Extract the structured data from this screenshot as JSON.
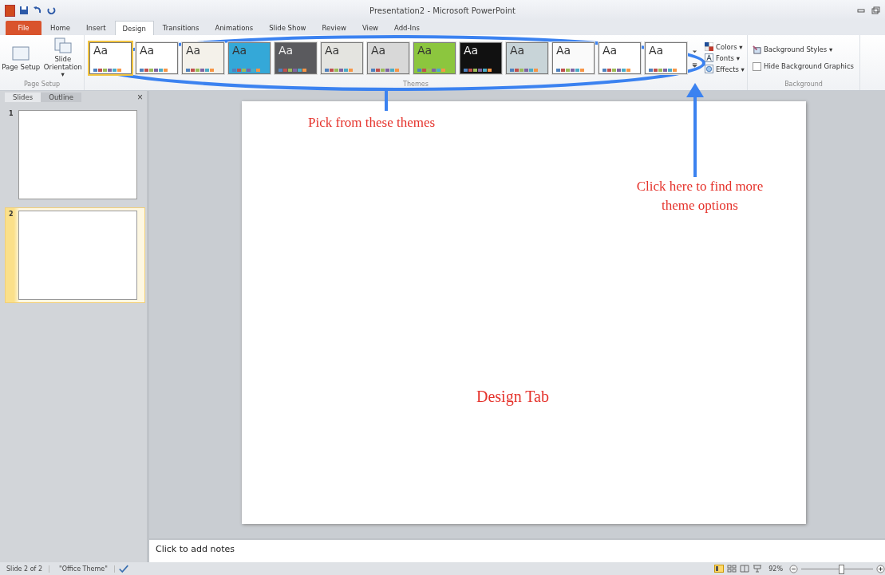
{
  "window": {
    "title": "Presentation2  -  Microsoft PowerPoint"
  },
  "tabs": [
    {
      "label": "File",
      "kind": "file",
      "selected": false
    },
    {
      "label": "Home",
      "kind": "tab",
      "selected": false
    },
    {
      "label": "Insert",
      "kind": "tab",
      "selected": false
    },
    {
      "label": "Design",
      "kind": "tab",
      "selected": true
    },
    {
      "label": "Transitions",
      "kind": "tab",
      "selected": false
    },
    {
      "label": "Animations",
      "kind": "tab",
      "selected": false
    },
    {
      "label": "Slide Show",
      "kind": "tab",
      "selected": false
    },
    {
      "label": "Review",
      "kind": "tab",
      "selected": false
    },
    {
      "label": "View",
      "kind": "tab",
      "selected": false
    },
    {
      "label": "Add-Ins",
      "kind": "tab",
      "selected": false
    }
  ],
  "page_setup": {
    "buttons": [
      {
        "label": "Page Setup",
        "kind": "page"
      },
      {
        "label": "Slide Orientation ▾",
        "kind": "orient"
      }
    ],
    "group_label": "Page Setup"
  },
  "themes": {
    "items": [
      {
        "label": "Aa",
        "color": "#ffffff",
        "selected": true
      },
      {
        "label": "Aa",
        "color": "#ffffff",
        "selected": false
      },
      {
        "label": "Aa",
        "color": "#f4f1ea",
        "selected": false
      },
      {
        "label": "Aa",
        "color": "#34a8d8",
        "selected": false
      },
      {
        "label": "Aa",
        "color": "#5a5a5e",
        "selected": false
      },
      {
        "label": "Aa",
        "color": "#e4e4e0",
        "selected": false
      },
      {
        "label": "Aa",
        "color": "#d8d8d8",
        "selected": false
      },
      {
        "label": "Aa",
        "color": "#8cc63e",
        "selected": false
      },
      {
        "label": "Aa",
        "color": "#111111",
        "selected": false
      },
      {
        "label": "Aa",
        "color": "#c8d4d8",
        "selected": false
      },
      {
        "label": "Aa",
        "color": "#fafafa",
        "selected": false
      },
      {
        "label": "Aa",
        "color": "#ffffff",
        "selected": false
      },
      {
        "label": "Aa",
        "color": "#ffffff",
        "selected": false
      }
    ],
    "group_label": "Themes",
    "options": [
      {
        "label": "Colors ▾",
        "kind": "colors"
      },
      {
        "label": "Fonts ▾",
        "kind": "fonts"
      },
      {
        "label": "Effects ▾",
        "kind": "effects"
      }
    ]
  },
  "background": {
    "styles": "Background Styles ▾",
    "hide_graphics": {
      "label": "Hide Background Graphics",
      "checked": false
    },
    "group_label": "Background"
  },
  "pane_tabs": [
    {
      "label": "Slides",
      "selected": true
    },
    {
      "label": "Outline",
      "selected": false
    }
  ],
  "pane_close": "×",
  "slides": [
    {
      "number": "1",
      "selected": false
    },
    {
      "number": "2",
      "selected": true
    }
  ],
  "notes": {
    "placeholder": "Click to add notes"
  },
  "annotations": {
    "themes_note": "Pick from these themes",
    "more_note": "Click here to find more theme options",
    "tab_note": "Design Tab"
  },
  "status_bar": {
    "slide": "Slide 2 of 2",
    "theme": "\"Office Theme\"",
    "zoom": "92%",
    "zoom_level": {
      "level": 0.55
    }
  }
}
